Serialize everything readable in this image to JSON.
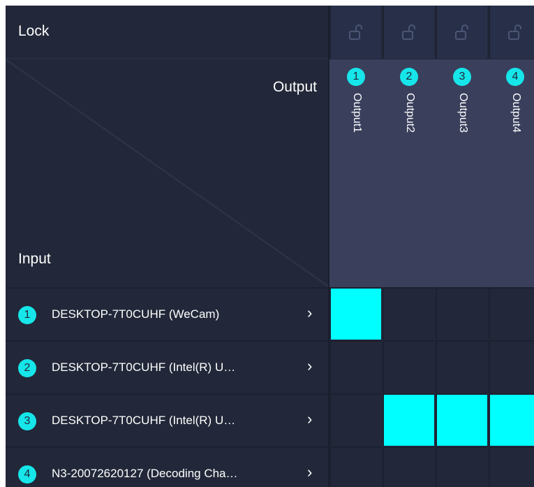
{
  "lock_label": "Lock",
  "corner": {
    "output_label": "Output",
    "input_label": "Input"
  },
  "outputs": [
    {
      "number": "1",
      "name": "Output1",
      "locked": false
    },
    {
      "number": "2",
      "name": "Output2",
      "locked": false
    },
    {
      "number": "3",
      "name": "Output3",
      "locked": false
    },
    {
      "number": "4",
      "name": "Output4",
      "locked": false
    }
  ],
  "inputs": [
    {
      "number": "1",
      "name": "DESKTOP-7T0CUHF (WeCam)"
    },
    {
      "number": "2",
      "name": "DESKTOP-7T0CUHF (Intel(R) U…"
    },
    {
      "number": "3",
      "name": "DESKTOP-7T0CUHF (Intel(R) U…"
    },
    {
      "number": "4",
      "name": "N3-20072620127 (Decoding Cha…"
    }
  ],
  "matrix": [
    [
      true,
      false,
      false,
      false
    ],
    [
      false,
      false,
      false,
      false
    ],
    [
      false,
      true,
      true,
      true
    ],
    [
      false,
      false,
      false,
      false
    ]
  ],
  "colors": {
    "accent": "#16e6ea",
    "active_cell": "#00ffff",
    "background": "#222839",
    "output_header": "#3a3f5c"
  },
  "icons": {
    "lock": "unlock-icon",
    "chevron": "chevron-right-icon"
  }
}
